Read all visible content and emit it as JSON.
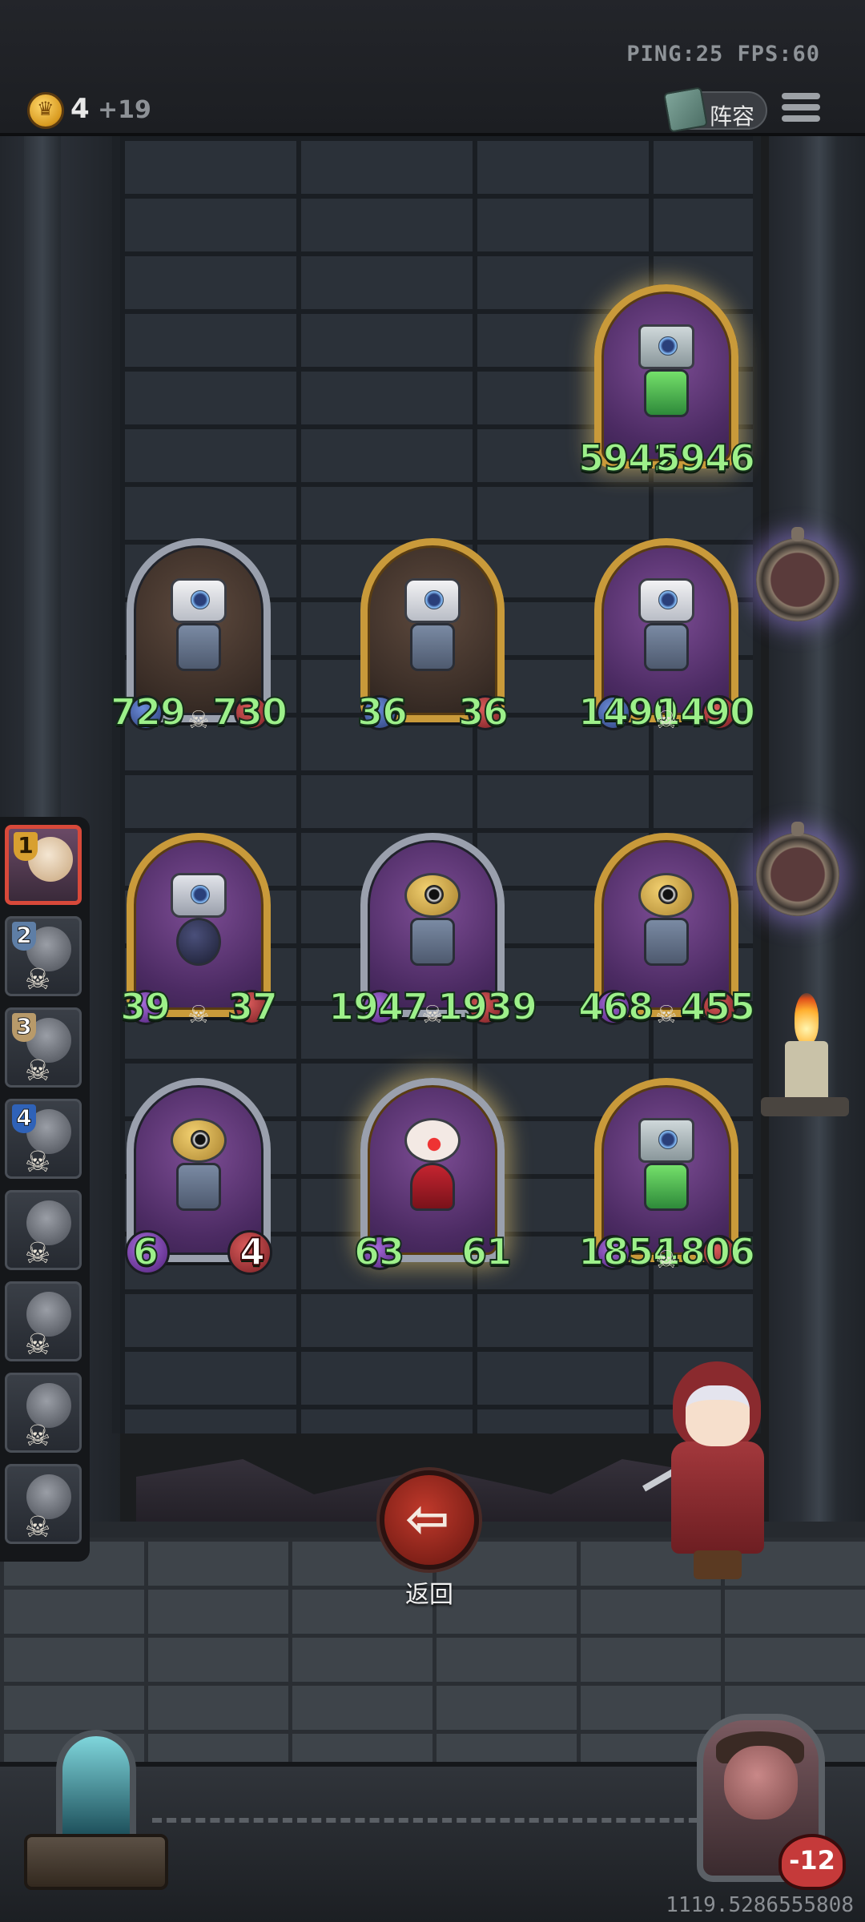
{
  "status": {
    "ping_fps": "PING:25   FPS:60"
  },
  "economy": {
    "gold": "4",
    "gold_income": "+19"
  },
  "header": {
    "lineup_label": "阵容",
    "lineup_icon": "book-icon",
    "menu_icon": "menu-icon"
  },
  "board": {
    "row1": [
      {
        "atk": "5942",
        "hp": "5946"
      }
    ],
    "row2": [
      {
        "atk": "729",
        "hp": "730"
      },
      {
        "atk": "36",
        "hp": "36"
      },
      {
        "atk": "1490",
        "hp": "1490"
      }
    ],
    "row3": [
      {
        "atk": "39",
        "hp": "37"
      },
      {
        "atk": "1947",
        "hp": "1939"
      },
      {
        "atk": "468",
        "hp": "455"
      }
    ],
    "row4": [
      {
        "atk": "6",
        "hp": "4"
      },
      {
        "atk": "63",
        "hp": "61"
      },
      {
        "atk": "1854",
        "hp": "1806"
      }
    ]
  },
  "roster": {
    "slots": [
      {
        "num": "1",
        "state": "active"
      },
      {
        "num": "2",
        "state": "dead"
      },
      {
        "num": "3",
        "state": "dead"
      },
      {
        "num": "4",
        "state": "dead"
      },
      {
        "num": "",
        "state": "dead"
      },
      {
        "num": "",
        "state": "dead"
      },
      {
        "num": "",
        "state": "dead"
      },
      {
        "num": "",
        "state": "dead"
      }
    ]
  },
  "actions": {
    "back_label": "返回",
    "back_icon": "arrow-left-icon"
  },
  "opponent": {
    "health": "-12"
  },
  "footer": {
    "seed": "1119.5286555808"
  },
  "colors": {
    "stat_green": "#9df08a",
    "gold_frame": "#c99a3a",
    "back_red": "#c0392b"
  }
}
